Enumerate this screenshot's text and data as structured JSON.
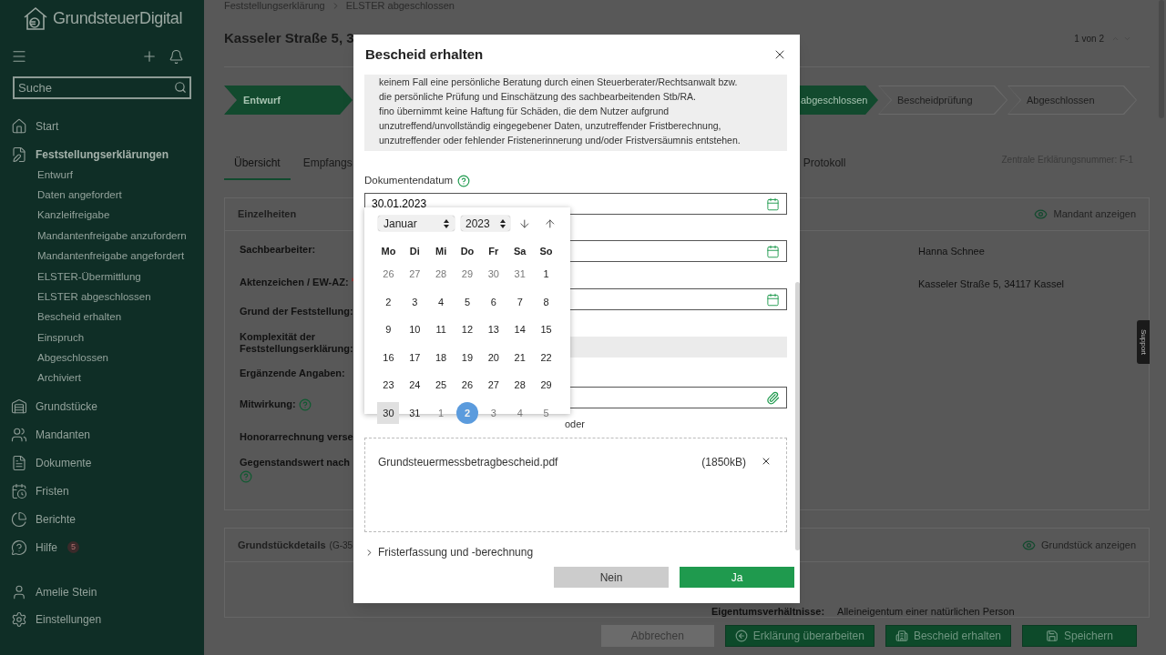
{
  "sidebar": {
    "logo": "GrundsteuerDigital",
    "search": {
      "placeholder": "Suche"
    },
    "items": [
      {
        "label": "Start",
        "kind": "home",
        "selected": false
      },
      {
        "label": "Feststellungserklärungen",
        "kind": "form",
        "selected": true,
        "children": [
          {
            "label": "Entwurf"
          },
          {
            "label": "Daten angefordert"
          },
          {
            "label": "Kanzleifreigabe"
          },
          {
            "label": "Mandantenfreigabe anzufordern"
          },
          {
            "label": "Mandantenfreigabe angefordert"
          },
          {
            "label": "ELSTER-Übermittlung"
          },
          {
            "label": "ELSTER abgeschlossen"
          },
          {
            "label": "Bescheid erhalten"
          },
          {
            "label": "Einspruch"
          },
          {
            "label": "Abgeschlossen"
          },
          {
            "label": "Archiviert"
          }
        ]
      },
      {
        "label": "Grundstücke",
        "kind": "property",
        "selected": false
      },
      {
        "label": "Mandanten",
        "kind": "clients",
        "selected": false
      },
      {
        "label": "Dokumente",
        "kind": "documents",
        "selected": false
      },
      {
        "label": "Fristen",
        "kind": "deadlines",
        "selected": false
      },
      {
        "label": "Berichte",
        "kind": "reports",
        "selected": false
      },
      {
        "label": "Hilfe",
        "kind": "help",
        "selected": false,
        "badge": "5"
      }
    ],
    "footer": [
      {
        "label": "Amelie Stein",
        "kind": "user"
      },
      {
        "label": "Einstellungen",
        "kind": "settings"
      }
    ]
  },
  "breadcrumb": [
    "Feststellungserklärung",
    "ELSTER abgeschlossen"
  ],
  "title": "Kasseler Straße 5, 3",
  "pager": "1 von 2",
  "steps": [
    {
      "label": "Entwurf",
      "selected": true
    },
    {
      "label": "abgeschlossen",
      "selected": true
    },
    {
      "label": "Bescheidprüfung",
      "selected": false
    },
    {
      "label": "Abgeschlossen",
      "selected": false
    }
  ],
  "tabs": [
    {
      "label": "Übersicht",
      "selected": true
    },
    {
      "label": "Empfangs",
      "selected": false
    },
    {
      "label": "Protokoll",
      "selected": false
    }
  ],
  "declaration_number": "Zentrale Erklärungsnummer: F-1",
  "details": {
    "title": "Einzelheiten",
    "action": "Mandant anzeigen",
    "rows": [
      {
        "label": "Sachbearbeiter:",
        "value": "Hanna Schnee",
        "required": false,
        "help": false
      },
      {
        "label": "Aktenzeichen / EW-AZ:",
        "value": "Kasseler Straße 5, 34117 Kassel",
        "required": true,
        "help": false
      },
      {
        "label": "Grund der Feststellung:",
        "required": false,
        "help": false
      },
      {
        "label": "Komplexität der Feststellungserklärung:",
        "required": false,
        "help": false
      },
      {
        "label": "Ergänzende Angaben:",
        "required": false,
        "help": false
      },
      {
        "label": "Mitwirkung:",
        "required": false,
        "help": true
      },
      {
        "label": "Honorarrechnung verse",
        "required": false,
        "help": false
      },
      {
        "label": "Gegenstandswert nach",
        "required": false,
        "help": true
      }
    ]
  },
  "property": {
    "title": "Grundstückdetails",
    "id": "(G-35",
    "action": "Grundstück anzeigen",
    "rows": [
      {
        "label": "Eigentumsverhältnisse:",
        "value": "Alleineigentum einer natürlichen Person"
      }
    ]
  },
  "actions": [
    {
      "label": "Abbrechen",
      "kind": "cancel"
    },
    {
      "label": "Erklärung überarbeiten",
      "kind": "revise"
    },
    {
      "label": "Bescheid erhalten",
      "kind": "notice"
    },
    {
      "label": "Speichern",
      "kind": "save"
    }
  ],
  "support": "Support",
  "dialog": {
    "title": "Bescheid erhalten",
    "notice": [
      "keinem Fall eine persönliche Beratung durch einen Steuerberater/Rechtsanwalt bzw.",
      "die persönliche Prüfung und Einschätzung des sachbearbeitenden Stb/RA.",
      "fino übernimmt keine Haftung für Schäden, die dem Nutzer aufgrund",
      "unzutreffend/unvollständig eingegebener Daten, unzutreffender Fristberechnung,",
      "unzutreffender oder fehlender Fristenerinnerung und/oder Fristversäumnis entstehen."
    ],
    "date_field": {
      "label": "Dokumentendatum",
      "help": true,
      "value": "30.01.2023"
    },
    "calendar": {
      "month": "Januar",
      "year": "2023",
      "weekdays": [
        "Mo",
        "Di",
        "Mi",
        "Do",
        "Fr",
        "Sa",
        "So"
      ],
      "weeks": [
        [
          {
            "day": "26",
            "outside": true,
            "selected": false,
            "today": false
          },
          {
            "day": "27",
            "outside": true,
            "selected": false,
            "today": false
          },
          {
            "day": "28",
            "outside": true,
            "selected": false,
            "today": false
          },
          {
            "day": "29",
            "outside": true,
            "selected": false,
            "today": false
          },
          {
            "day": "30",
            "outside": true,
            "selected": false,
            "today": false
          },
          {
            "day": "31",
            "outside": true,
            "selected": false,
            "today": false
          },
          {
            "day": "1",
            "outside": false,
            "selected": false,
            "today": false
          }
        ],
        [
          {
            "day": "2",
            "outside": false,
            "selected": false,
            "today": false
          },
          {
            "day": "3",
            "outside": false,
            "selected": false,
            "today": false
          },
          {
            "day": "4",
            "outside": false,
            "selected": false,
            "today": false
          },
          {
            "day": "5",
            "outside": false,
            "selected": false,
            "today": false
          },
          {
            "day": "6",
            "outside": false,
            "selected": false,
            "today": false
          },
          {
            "day": "7",
            "outside": false,
            "selected": false,
            "today": false
          },
          {
            "day": "8",
            "outside": false,
            "selected": false,
            "today": false
          }
        ],
        [
          {
            "day": "9",
            "outside": false,
            "selected": false,
            "today": false
          },
          {
            "day": "10",
            "outside": false,
            "selected": false,
            "today": false
          },
          {
            "day": "11",
            "outside": false,
            "selected": false,
            "today": false
          },
          {
            "day": "12",
            "outside": false,
            "selected": false,
            "today": false
          },
          {
            "day": "13",
            "outside": false,
            "selected": false,
            "today": false
          },
          {
            "day": "14",
            "outside": false,
            "selected": false,
            "today": false
          },
          {
            "day": "15",
            "outside": false,
            "selected": false,
            "today": false
          }
        ],
        [
          {
            "day": "16",
            "outside": false,
            "selected": false,
            "today": false
          },
          {
            "day": "17",
            "outside": false,
            "selected": false,
            "today": false
          },
          {
            "day": "18",
            "outside": false,
            "selected": false,
            "today": false
          },
          {
            "day": "19",
            "outside": false,
            "selected": false,
            "today": false
          },
          {
            "day": "20",
            "outside": false,
            "selected": false,
            "today": false
          },
          {
            "day": "21",
            "outside": false,
            "selected": false,
            "today": false
          },
          {
            "day": "22",
            "outside": false,
            "selected": false,
            "today": false
          }
        ],
        [
          {
            "day": "23",
            "outside": false,
            "selected": false,
            "today": false
          },
          {
            "day": "24",
            "outside": false,
            "selected": false,
            "today": false
          },
          {
            "day": "25",
            "outside": false,
            "selected": false,
            "today": false
          },
          {
            "day": "26",
            "outside": false,
            "selected": false,
            "today": false
          },
          {
            "day": "27",
            "outside": false,
            "selected": false,
            "today": false
          },
          {
            "day": "28",
            "outside": false,
            "selected": false,
            "today": false
          },
          {
            "day": "29",
            "outside": false,
            "selected": false,
            "today": false
          }
        ],
        [
          {
            "day": "30",
            "outside": false,
            "selected": true,
            "today": false
          },
          {
            "day": "31",
            "outside": false,
            "selected": false,
            "today": false
          },
          {
            "day": "1",
            "outside": true,
            "selected": false,
            "today": false
          },
          {
            "day": "2",
            "outside": true,
            "selected": false,
            "today": true
          },
          {
            "day": "3",
            "outside": true,
            "selected": false,
            "today": false
          },
          {
            "day": "4",
            "outside": true,
            "selected": false,
            "today": false
          },
          {
            "day": "5",
            "outside": true,
            "selected": false,
            "today": false
          }
        ]
      ]
    },
    "fields": [
      {
        "kind": "date"
      },
      {
        "kind": "date"
      },
      {
        "kind": "disabled"
      },
      {
        "kind": "file"
      }
    ],
    "or_text": "oder",
    "file": {
      "name": "Grundsteuermessbetragbescheid.pdf",
      "size": "(1850kB)"
    },
    "section": {
      "label": "Fristerfassung und -berechnung",
      "expanded": false
    },
    "buttons": [
      {
        "label": "Nein",
        "kind": "secondary"
      },
      {
        "label": "Ja",
        "kind": "primary"
      }
    ]
  }
}
